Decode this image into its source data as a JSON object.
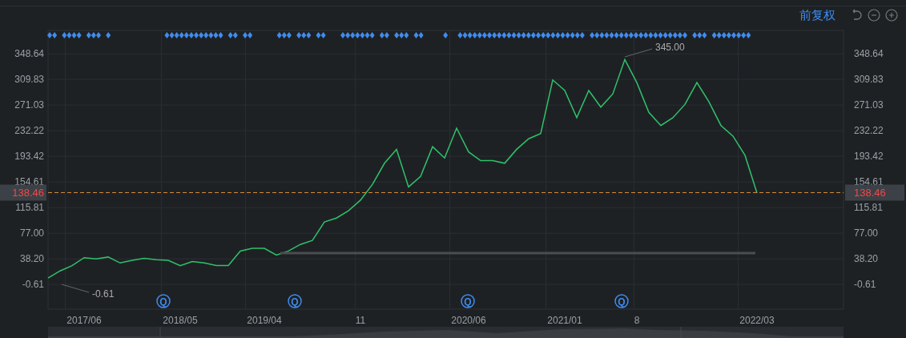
{
  "toolbar": {
    "adjust_label": "前复权"
  },
  "chart": {
    "chart_data": {
      "type": "line",
      "grid": true,
      "categories": [
        null,
        null,
        null,
        "2017/06",
        null,
        null,
        null,
        null,
        null,
        null,
        null,
        "2018/05",
        null,
        null,
        null,
        null,
        null,
        null,
        "2019/04",
        null,
        null,
        null,
        null,
        null,
        null,
        null,
        "11",
        null,
        null,
        null,
        null,
        null,
        null,
        null,
        null,
        "2020/06",
        null,
        null,
        null,
        null,
        null,
        null,
        null,
        "2021/01",
        null,
        null,
        null,
        null,
        null,
        "8",
        null,
        null,
        null,
        null,
        null,
        null,
        null,
        null,
        null,
        "2022/03"
      ],
      "series": [
        {
          "color": "#2fc26a",
          "values": [
            9,
            20,
            28,
            40,
            38,
            41,
            32,
            36,
            39,
            37,
            36,
            28,
            34,
            32,
            28,
            28,
            50,
            54,
            54,
            44,
            50,
            60,
            66,
            94,
            100,
            111,
            127,
            151,
            183,
            204,
            147,
            163,
            208,
            191,
            236,
            200,
            187,
            187,
            183,
            204,
            220,
            228,
            309,
            293,
            252,
            293,
            268,
            288,
            340,
            305,
            260,
            240,
            252,
            272,
            305,
            276,
            240,
            224,
            195,
            138
          ]
        }
      ],
      "ylim": [
        -38,
        384
      ],
      "yticks": [
        {
          "value": 348.64,
          "label": "348.64"
        },
        {
          "value": 309.83,
          "label": "309.83"
        },
        {
          "value": 271.03,
          "label": "271.03"
        },
        {
          "value": 232.22,
          "label": "232.22"
        },
        {
          "value": 193.42,
          "label": "193.42"
        },
        {
          "value": 154.61,
          "label": "154.61"
        },
        {
          "value": 115.81,
          "label": "115.81"
        },
        {
          "value": 77.0,
          "label": "77.00"
        },
        {
          "value": 38.2,
          "label": "38.20"
        },
        {
          "value": -0.61,
          "label": "-0.61"
        }
      ],
      "annotations": [
        {
          "text": "345.00"
        },
        {
          "text": "-0.61"
        }
      ],
      "ref_lines": [
        {
          "axis": "y",
          "value": 138.46,
          "label": "138.46",
          "color": "#d98a3a"
        },
        {
          "axis": "y",
          "value": 47,
          "color": "#4a4d51"
        }
      ]
    },
    "event_markers": [
      {
        "label": "Q"
      },
      {
        "label": "Q"
      },
      {
        "label": "Q"
      },
      {
        "label": "Q"
      }
    ]
  }
}
